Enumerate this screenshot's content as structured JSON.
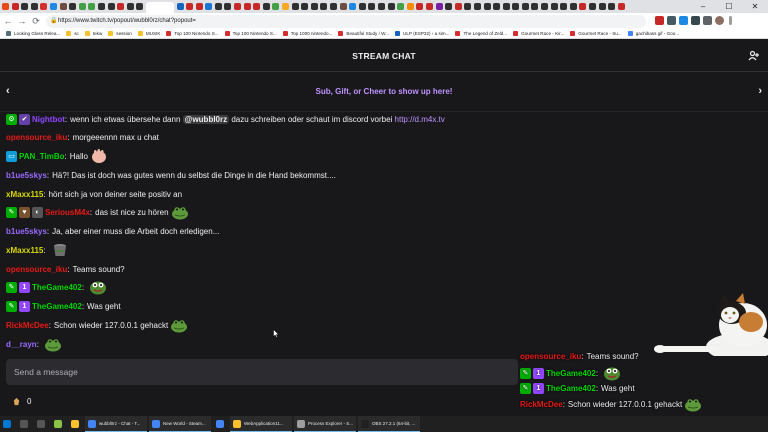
{
  "browser": {
    "url": "https://www.twitch.tv/popout/wubbl0rz/chat?popout=",
    "tab_colors": [
      "#e64a19",
      "#c62828",
      "#303030",
      "#303030",
      "#d32f2f",
      "#1e88e5",
      "#6d4c41",
      "#303030",
      "#43a047",
      "#43a047",
      "#303030",
      "#303030",
      "#c62828",
      "#303030",
      "#303030",
      "#4285f4",
      "#1565c0",
      "#c62828",
      "#c62828",
      "#1976d2",
      "#303030",
      "#303030",
      "#c62828",
      "#c62828",
      "#c62828",
      "#303030",
      "#43a047",
      "#f9a825",
      "#303030",
      "#303030",
      "#303030",
      "#303030",
      "#303030",
      "#6d4c41",
      "#1e88e5",
      "#303030",
      "#303030",
      "#303030",
      "#303030",
      "#43a047",
      "#fb8c00",
      "#c62828",
      "#c62828",
      "#7b1fa2",
      "#303030",
      "#c62828",
      "#303030",
      "#303030",
      "#303030",
      "#303030",
      "#303030",
      "#303030",
      "#303030",
      "#303030",
      "#303030",
      "#303030",
      "#303030",
      "#303030",
      "#c62828",
      "#303030",
      "#303030",
      "#303030",
      "#c62828"
    ],
    "window_controls": [
      "–",
      "☐",
      "✕"
    ],
    "nav": [
      "←",
      "→",
      "⟳"
    ],
    "bookmarks": [
      {
        "label": "Looking Glass Relea...",
        "color": "#546e7a"
      },
      {
        "label": "sc",
        "color": "#fbc02d"
      },
      {
        "label": "tekw",
        "color": "#fbc02d"
      },
      {
        "label": "session",
        "color": "#fbc02d"
      },
      {
        "label": "MUSIK",
        "color": "#fbc02d"
      },
      {
        "label": "Top 100 Nintendo S...",
        "color": "#d32f2f"
      },
      {
        "label": "Top 100 Nintendo S...",
        "color": "#d32f2f"
      },
      {
        "label": "Top 1000 nintendo...",
        "color": "#d32f2f"
      },
      {
        "label": "Beautiful Study / W...",
        "color": "#d32f2f"
      },
      {
        "label": "ULP (ESP32) › a sim...",
        "color": "#1565c0"
      },
      {
        "label": "The Legend of Zeld...",
        "color": "#d32f2f"
      },
      {
        "label": "Gourmet Race - Kir...",
        "color": "#d32f2f"
      },
      {
        "label": "Gourmet Race - Su...",
        "color": "#d32f2f"
      },
      {
        "label": "gachibass gif - Goo...",
        "color": "#4285f4"
      }
    ]
  },
  "chat": {
    "header_title": "STREAM CHAT",
    "promo_text": "Sub, Gift, or Cheer to show up here!",
    "arrow_left": "‹",
    "arrow_right": "›",
    "input_placeholder": "Send a message",
    "points": "0",
    "messages": [
      {
        "badges": [
          {
            "color": "#00ad03",
            "glyph": "⚙"
          },
          {
            "color": "#6441a5",
            "glyph": "✔"
          }
        ],
        "user": "Nightbot",
        "color": "#9147ff",
        "parts": [
          {
            "t": "wenn ich etwas übersehe dann "
          },
          {
            "t": "@wubbl0rz",
            "mention": true
          },
          {
            "t": " dazu schreiben oder schaut im discord vorbei "
          },
          {
            "t": "http://d.m4x.tv",
            "link": true
          }
        ]
      },
      {
        "badges": [],
        "user": "opensource_iku",
        "color": "#e91916",
        "parts": [
          {
            "t": "morgeeennn max u chat"
          }
        ]
      },
      {
        "badges": [
          {
            "color": "#0e9dd9",
            "glyph": "▭"
          }
        ],
        "user": "PAN_TimBo",
        "color": "#00d600",
        "parts": [
          {
            "t": "Hallo"
          }
        ],
        "emote": "hand"
      },
      {
        "badges": [],
        "user": "b1ue5skys",
        "color": "#9a6bff",
        "parts": [
          {
            "t": "Hä?! Das ist doch was gutes wenn du selbst die Dinge in die Hand bekommst...."
          }
        ]
      },
      {
        "badges": [],
        "user": "xMaxx115",
        "color": "#dada00",
        "parts": [
          {
            "t": "hört sich ja von deiner seite positiv an"
          }
        ]
      },
      {
        "badges": [
          {
            "color": "#00ad03",
            "glyph": "✎"
          },
          {
            "color": "#7a5230",
            "glyph": "♥"
          },
          {
            "color": "#555",
            "glyph": "◐"
          }
        ],
        "user": "SeriousM4x",
        "color": "#e91916",
        "parts": [
          {
            "t": "das ist nice zu hören"
          }
        ],
        "emote": "frog"
      },
      {
        "badges": [],
        "user": "b1ue5skys",
        "color": "#9a6bff",
        "parts": [
          {
            "t": "Ja, aber einer muss die Arbeit doch erledigen..."
          }
        ]
      },
      {
        "badges": [],
        "user": "xMaxx115",
        "color": "#dada00",
        "parts": [],
        "emote": "bucket"
      },
      {
        "badges": [],
        "user": "opensource_iku",
        "color": "#e91916",
        "parts": [
          {
            "t": "Teams sound?"
          }
        ]
      },
      {
        "badges": [
          {
            "color": "#00ad03",
            "glyph": "✎"
          },
          {
            "color": "#9147ff",
            "glyph": "1"
          }
        ],
        "user": "TheGame402",
        "color": "#00d600",
        "parts": [],
        "emote": "pepe"
      },
      {
        "badges": [
          {
            "color": "#00ad03",
            "glyph": "✎"
          },
          {
            "color": "#9147ff",
            "glyph": "1"
          }
        ],
        "user": "TheGame402",
        "color": "#00d600",
        "parts": [
          {
            "t": "Was geht"
          }
        ]
      },
      {
        "badges": [],
        "user": "RickMcDee",
        "color": "#e91916",
        "parts": [
          {
            "t": "Schon wieder 127.0.0.1 gehackt"
          }
        ],
        "emote": "frog"
      },
      {
        "badges": [],
        "user": "d__rayn",
        "color": "#9a6bff",
        "parts": [],
        "emote": "frog"
      }
    ]
  },
  "overlay": {
    "messages": [
      {
        "badges": [],
        "user": "opensource_iku",
        "color": "#e91916",
        "parts": [
          {
            "t": "Teams sound?"
          }
        ]
      },
      {
        "badges": [
          {
            "color": "#00ad03",
            "glyph": "✎"
          },
          {
            "color": "#9147ff",
            "glyph": "1"
          }
        ],
        "user": "TheGame402",
        "color": "#00d600",
        "parts": [],
        "emote": "pepe"
      },
      {
        "badges": [
          {
            "color": "#00ad03",
            "glyph": "✎"
          },
          {
            "color": "#9147ff",
            "glyph": "1"
          }
        ],
        "user": "TheGame402",
        "color": "#00d600",
        "parts": [
          {
            "t": "Was geht"
          }
        ]
      },
      {
        "badges": [],
        "user": "RickMcDee",
        "color": "#e91916",
        "parts": [
          {
            "t": "Schon wieder 127.0.0.1 gehackt"
          }
        ],
        "emote": "frog"
      },
      {
        "badges": [],
        "user": "d__rayn",
        "color": "#9a6bff",
        "parts": [],
        "emote": "frog"
      }
    ]
  },
  "taskbar": {
    "items": [
      {
        "label": "",
        "color": "#0078d4",
        "icon": "windows-start-icon"
      },
      {
        "label": "",
        "color": "#555",
        "icon": "search-icon"
      },
      {
        "label": "",
        "color": "#555",
        "icon": "task-view-icon"
      },
      {
        "label": "",
        "color": "#8bc34a",
        "icon": "app-icon"
      },
      {
        "label": "",
        "color": "#fbc02d",
        "icon": "file-explorer-icon"
      },
      {
        "label": "wubbl0rz - Chat - T...",
        "color": "#4285f4",
        "icon": "chrome-icon",
        "app": true
      },
      {
        "label": "New World - Steam...",
        "color": "#4285f4",
        "icon": "chrome-icon",
        "app": true
      },
      {
        "label": "",
        "color": "#4285f4",
        "icon": "chrome-icon"
      },
      {
        "label": "WebApplication11...",
        "color": "#fbc02d",
        "icon": "folder-icon",
        "app": true
      },
      {
        "label": "Process Explorer - S...",
        "color": "#9e9e9e",
        "icon": "process-explorer-icon",
        "app": true
      },
      {
        "label": "OBS 27.2.1 (64-bit, ...",
        "color": "#212121",
        "icon": "obs-icon",
        "app": true
      }
    ]
  }
}
